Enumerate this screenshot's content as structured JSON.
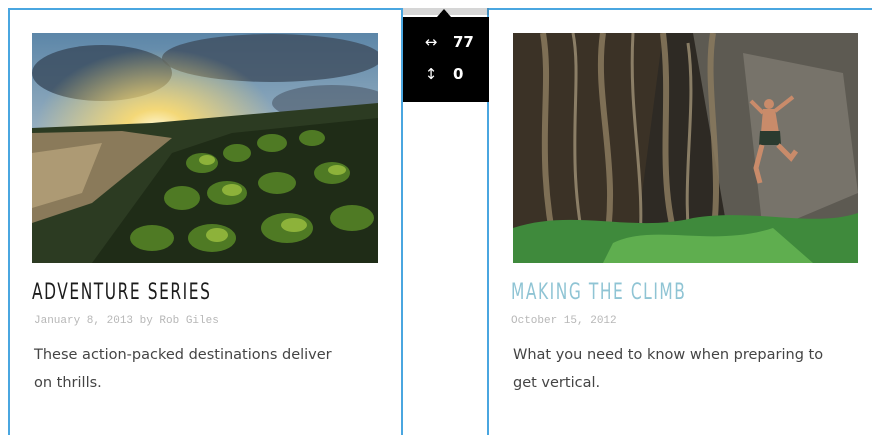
{
  "cards": [
    {
      "title": "Adventure Series",
      "date": "January 8, 2013 by Rob Giles",
      "description": "These action-packed destinations deliver on thrills.",
      "image": "sunset-coastal-plants-photo"
    },
    {
      "title": "Making the Climb",
      "date": "October 15, 2012",
      "description": "What you need to know when preparing to get vertical.",
      "image": "rock-climber-jungle-photo"
    }
  ],
  "spacing_tooltip": {
    "horizontal_icon": "↔",
    "horizontal_value": "77",
    "vertical_icon": "↕",
    "vertical_value": "0"
  },
  "colors": {
    "card_border": "#4aa6e0",
    "title_dark": "#1c1c1c",
    "title_accent": "#8fc4d4",
    "date_gray": "#b7b7b7",
    "tooltip_bg": "#000000"
  }
}
